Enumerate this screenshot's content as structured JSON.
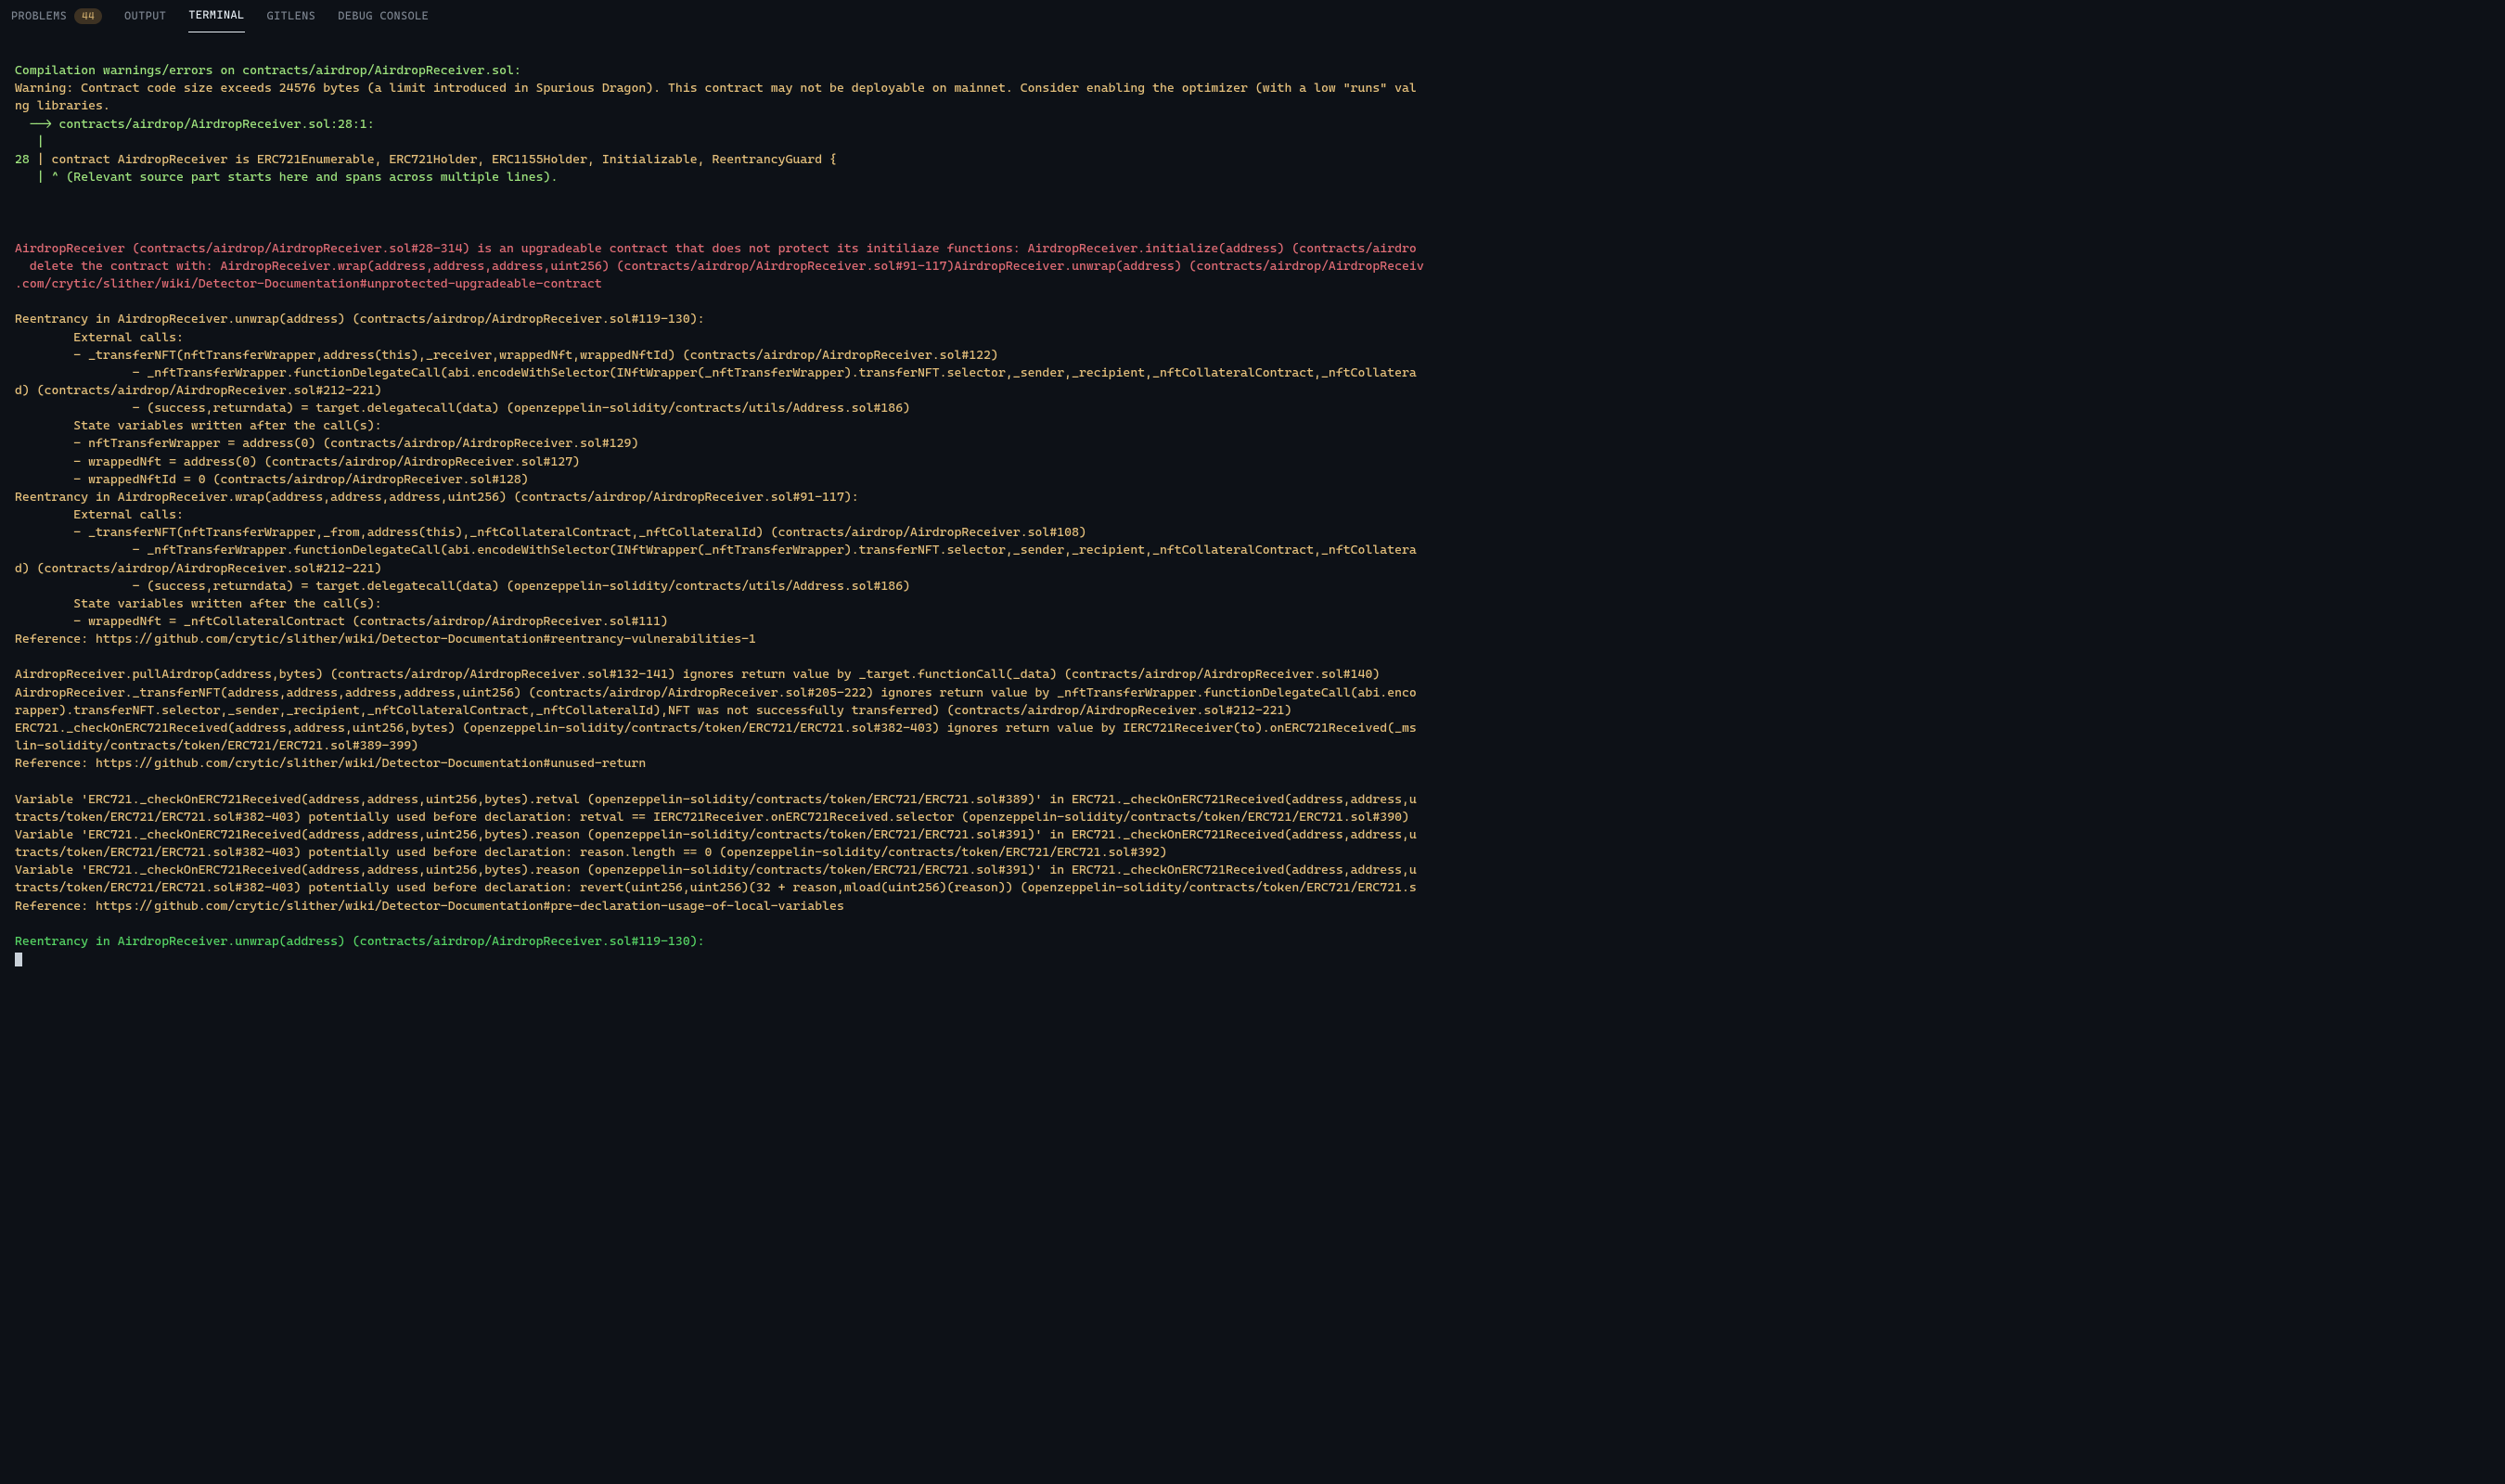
{
  "tabs": {
    "problems": "PROBLEMS",
    "problems_count": "44",
    "output": "OUTPUT",
    "terminal": "TERMINAL",
    "gitlens": "GITLENS",
    "debug": "DEBUG CONSOLE"
  },
  "term": {
    "l01": "Compilation warnings/errors on contracts/airdrop/AirdropReceiver.sol:",
    "l02": "Warning: Contract code size exceeds 24576 bytes (a limit introduced in Spurious Dragon). This contract may not be deployable on mainnet. Consider enabling the optimizer (with a low \"runs\" val",
    "l03": "ng libraries.",
    "l04": "  --> contracts/airdrop/AirdropReceiver.sol:28:1:",
    "l05": "   |",
    "l06a": "28",
    "l06b": " | contract AirdropReceiver is ERC721Enumerable, ERC721Holder, ERC1155Holder, Initializable, ReentrancyGuard {",
    "l07": "   | ^ (Relevant source part starts here and spans across multiple lines).",
    "l08": "AirdropReceiver (contracts/airdrop/AirdropReceiver.sol#28-314) is an upgradeable contract that does not protect its initiliaze functions: AirdropReceiver.initialize(address) (contracts/airdro",
    "l09": "  delete the contract with: AirdropReceiver.wrap(address,address,address,uint256) (contracts/airdrop/AirdropReceiver.sol#91-117)AirdropReceiver.unwrap(address) (contracts/airdrop/AirdropReceiv",
    "l10": ".com/crytic/slither/wiki/Detector-Documentation#unprotected-upgradeable-contract",
    "l11": "Reentrancy in AirdropReceiver.unwrap(address) (contracts/airdrop/AirdropReceiver.sol#119-130):",
    "l12": "        External calls:",
    "l13": "        - _transferNFT(nftTransferWrapper,address(this),_receiver,wrappedNft,wrappedNftId) (contracts/airdrop/AirdropReceiver.sol#122)",
    "l14": "                - _nftTransferWrapper.functionDelegateCall(abi.encodeWithSelector(INftWrapper(_nftTransferWrapper).transferNFT.selector,_sender,_recipient,_nftCollateralContract,_nftCollatera",
    "l15": "d) (contracts/airdrop/AirdropReceiver.sol#212-221)",
    "l16": "                - (success,returndata) = target.delegatecall(data) (openzeppelin-solidity/contracts/utils/Address.sol#186)",
    "l17": "        State variables written after the call(s):",
    "l18": "        - nftTransferWrapper = address(0) (contracts/airdrop/AirdropReceiver.sol#129)",
    "l19": "        - wrappedNft = address(0) (contracts/airdrop/AirdropReceiver.sol#127)",
    "l20": "        - wrappedNftId = 0 (contracts/airdrop/AirdropReceiver.sol#128)",
    "l21": "Reentrancy in AirdropReceiver.wrap(address,address,address,uint256) (contracts/airdrop/AirdropReceiver.sol#91-117):",
    "l22": "        External calls:",
    "l23": "        - _transferNFT(nftTransferWrapper,_from,address(this),_nftCollateralContract,_nftCollateralId) (contracts/airdrop/AirdropReceiver.sol#108)",
    "l24": "                - _nftTransferWrapper.functionDelegateCall(abi.encodeWithSelector(INftWrapper(_nftTransferWrapper).transferNFT.selector,_sender,_recipient,_nftCollateralContract,_nftCollatera",
    "l25": "d) (contracts/airdrop/AirdropReceiver.sol#212-221)",
    "l26": "                - (success,returndata) = target.delegatecall(data) (openzeppelin-solidity/contracts/utils/Address.sol#186)",
    "l27": "        State variables written after the call(s):",
    "l28": "        - wrappedNft = _nftCollateralContract (contracts/airdrop/AirdropReceiver.sol#111)",
    "l29": "Reference: https://github.com/crytic/slither/wiki/Detector-Documentation#reentrancy-vulnerabilities-1",
    "l30": "AirdropReceiver.pullAirdrop(address,bytes) (contracts/airdrop/AirdropReceiver.sol#132-141) ignores return value by _target.functionCall(_data) (contracts/airdrop/AirdropReceiver.sol#140)",
    "l31": "AirdropReceiver._transferNFT(address,address,address,address,uint256) (contracts/airdrop/AirdropReceiver.sol#205-222) ignores return value by _nftTransferWrapper.functionDelegateCall(abi.enco",
    "l32": "rapper).transferNFT.selector,_sender,_recipient,_nftCollateralContract,_nftCollateralId),NFT was not successfully transferred) (contracts/airdrop/AirdropReceiver.sol#212-221)",
    "l33": "ERC721._checkOnERC721Received(address,address,uint256,bytes) (openzeppelin-solidity/contracts/token/ERC721/ERC721.sol#382-403) ignores return value by IERC721Receiver(to).onERC721Received(_ms",
    "l34": "lin-solidity/contracts/token/ERC721/ERC721.sol#389-399)",
    "l35": "Reference: https://github.com/crytic/slither/wiki/Detector-Documentation#unused-return",
    "l36": "Variable 'ERC721._checkOnERC721Received(address,address,uint256,bytes).retval (openzeppelin-solidity/contracts/token/ERC721/ERC721.sol#389)' in ERC721._checkOnERC721Received(address,address,u",
    "l37": "tracts/token/ERC721/ERC721.sol#382-403) potentially used before declaration: retval == IERC721Receiver.onERC721Received.selector (openzeppelin-solidity/contracts/token/ERC721/ERC721.sol#390)",
    "l38": "Variable 'ERC721._checkOnERC721Received(address,address,uint256,bytes).reason (openzeppelin-solidity/contracts/token/ERC721/ERC721.sol#391)' in ERC721._checkOnERC721Received(address,address,u",
    "l39": "tracts/token/ERC721/ERC721.sol#382-403) potentially used before declaration: reason.length == 0 (openzeppelin-solidity/contracts/token/ERC721/ERC721.sol#392)",
    "l40": "Variable 'ERC721._checkOnERC721Received(address,address,uint256,bytes).reason (openzeppelin-solidity/contracts/token/ERC721/ERC721.sol#391)' in ERC721._checkOnERC721Received(address,address,u",
    "l41": "tracts/token/ERC721/ERC721.sol#382-403) potentially used before declaration: revert(uint256,uint256)(32 + reason,mload(uint256)(reason)) (openzeppelin-solidity/contracts/token/ERC721/ERC721.s",
    "l42": "Reference: https://github.com/crytic/slither/wiki/Detector-Documentation#pre-declaration-usage-of-local-variables",
    "l43": "Reentrancy in AirdropReceiver.unwrap(address) (contracts/airdrop/AirdropReceiver.sol#119-130):"
  }
}
